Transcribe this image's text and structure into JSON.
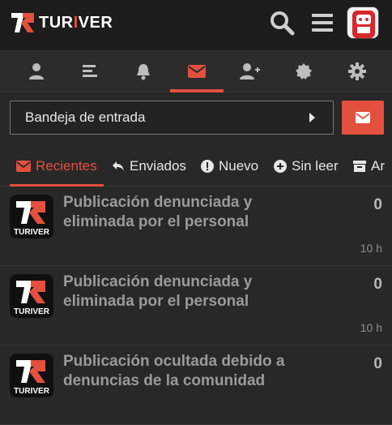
{
  "header": {
    "logo_text_a": "TUR",
    "logo_text_b": "I",
    "logo_text_c": "VER",
    "icons": [
      "search-icon",
      "menu-icon"
    ],
    "avatar": "user-avatar"
  },
  "tabs": [
    {
      "icon": "user-icon",
      "active": false
    },
    {
      "icon": "list-icon",
      "active": false
    },
    {
      "icon": "bell-icon",
      "active": false
    },
    {
      "icon": "envelope-icon",
      "active": true
    },
    {
      "icon": "add-user-icon",
      "active": false
    },
    {
      "icon": "badge-icon",
      "active": false
    },
    {
      "icon": "gear-icon",
      "active": false
    }
  ],
  "folder": {
    "label": "Bandeja de entrada"
  },
  "filters": [
    {
      "label": "Recientes",
      "icon": "envelope-icon",
      "active": true
    },
    {
      "label": "Enviados",
      "icon": "reply-icon",
      "active": false
    },
    {
      "label": "Nuevo",
      "icon": "exclamation-icon",
      "active": false
    },
    {
      "label": "Sin leer",
      "icon": "plus-circle-icon",
      "active": false
    },
    {
      "label": "Ar",
      "icon": "archive-icon",
      "active": false
    }
  ],
  "messages": [
    {
      "title": "Publicación denunciada y eliminada por el personal",
      "count": "0",
      "time": "10 h",
      "logo_text": "TURIVER"
    },
    {
      "title": "Publicación denunciada y eliminada por el personal",
      "count": "0",
      "time": "10 h",
      "logo_text": "TURIVER"
    },
    {
      "title": "Publicación ocultada debido a denuncias de la comunidad",
      "count": "0",
      "time": "",
      "logo_text": "TURIVER"
    }
  ],
  "colors": {
    "accent": "#e3503e",
    "background": "#282828",
    "header": "#1c1c1c"
  }
}
